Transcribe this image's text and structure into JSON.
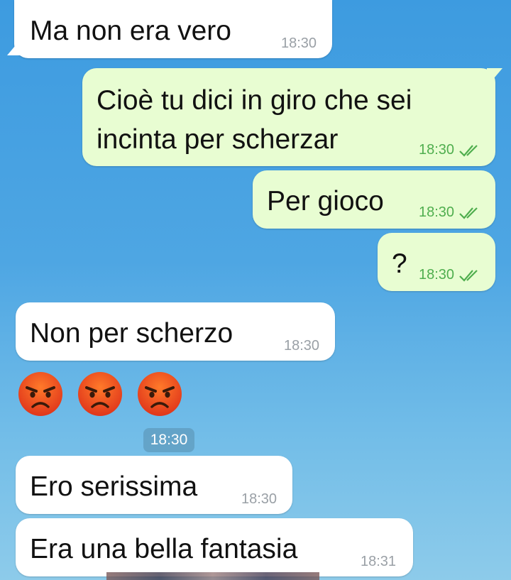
{
  "messages": [
    {
      "id": "m1",
      "direction": "in",
      "text": "Ma non era vero",
      "time": "18:30"
    },
    {
      "id": "m2",
      "direction": "out",
      "text": "Cioè tu dici in giro che sei\nincinta per scherzar",
      "time": "18:30",
      "status": "read-double-check"
    },
    {
      "id": "m3",
      "direction": "out",
      "text": "Per gioco",
      "time": "18:30",
      "status": "read-double-check"
    },
    {
      "id": "m4",
      "direction": "out",
      "text": "?",
      "time": "18:30",
      "status": "read-double-check"
    },
    {
      "id": "m5",
      "direction": "in",
      "text": "Non per scherzo",
      "time": "18:30"
    },
    {
      "id": "m6",
      "direction": "in",
      "emoji": [
        "angry-face-emoji",
        "angry-face-emoji",
        "angry-face-emoji"
      ]
    },
    {
      "id": "m7",
      "direction": "in",
      "text": "Ero serissima",
      "time": "18:30"
    },
    {
      "id": "m8",
      "direction": "in",
      "text": "Era una bella fantasia",
      "time": "18:31"
    }
  ],
  "time_chip": "18:30",
  "colors": {
    "incoming_bubble": "#ffffff",
    "outgoing_bubble": "#e8fdd2",
    "outgoing_time": "#4fae4e",
    "incoming_time": "#9aa0a6"
  }
}
